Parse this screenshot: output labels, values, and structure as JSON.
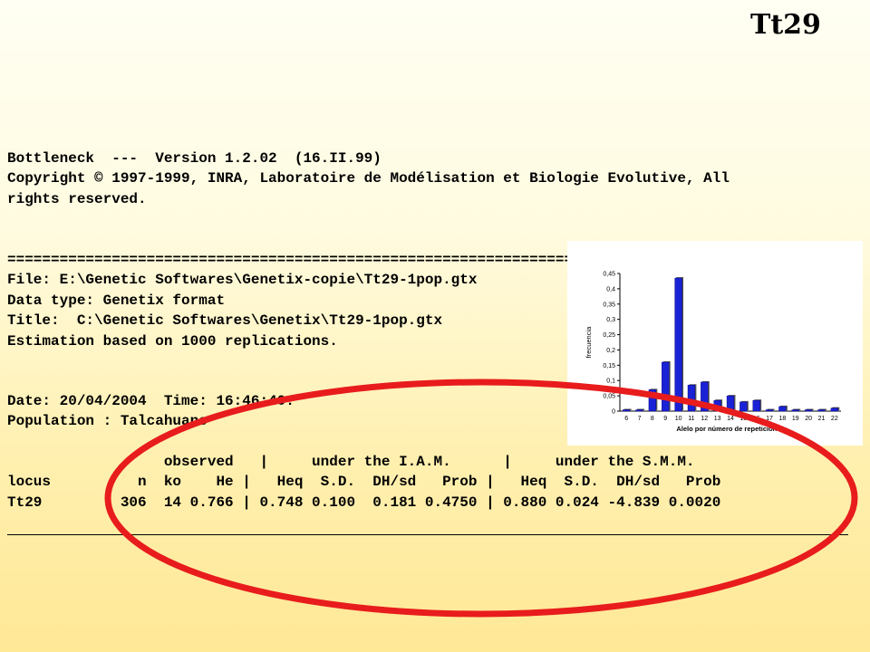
{
  "slide": {
    "title": "Tt29"
  },
  "output": {
    "header_lines": [
      "Bottleneck  ---  Version 1.2.02  (16.II.99)",
      "Copyright © 1997-1999, INRA, Laboratoire de Modélisation et Biologie Evolutive, All",
      "rights reserved."
    ],
    "separator": "==========================================================================",
    "file_lines": [
      "File: E:\\Genetic Softwares\\Genetix-copie\\Tt29-1pop.gtx",
      "Data type: Genetix format",
      "Title:  C:\\Genetic Softwares\\Genetix\\Tt29-1pop.gtx",
      "Estimation based on 1000 replications."
    ],
    "date_line": "Date: 20/04/2004  Time: 16:46:40.",
    "population_line": "Population : Talcahuano",
    "table": {
      "group_header": "                  observed   |     under the I.A.M.      |     under the S.M.M.",
      "column_header": "locus          n  ko    He |   Heq  S.D.  DH/sd   Prob |   Heq  S.D.  DH/sd   Prob",
      "row": "Tt29         306  14 0.766 | 0.748 0.100  0.181 0.4750 | 0.880 0.024 -4.839 0.0020"
    }
  },
  "chart_data": {
    "type": "bar",
    "categories": [
      "6",
      "7",
      "8",
      "9",
      "10",
      "11",
      "12",
      "13",
      "14",
      "15",
      "16",
      "17",
      "18",
      "19",
      "20",
      "21",
      "22"
    ],
    "values": [
      0.0,
      0.0,
      0.07,
      0.16,
      0.435,
      0.085,
      0.095,
      0.035,
      0.05,
      0.03,
      0.035,
      0.0,
      0.015,
      0.0,
      0.0,
      0.0,
      0.01
    ],
    "ylim": [
      0,
      0.45
    ],
    "yticks": [
      "0",
      "0,05",
      "0,1",
      "0,15",
      "0,2",
      "0,25",
      "0,3",
      "0,35",
      "0,4",
      "0,45"
    ],
    "ylabel": "frecuencia",
    "xlabel": "Alelo por número de repeticiones",
    "grid": false,
    "bar_color": "#1a22d6"
  },
  "annotation": {
    "ellipse_color": "#e81c1c"
  }
}
